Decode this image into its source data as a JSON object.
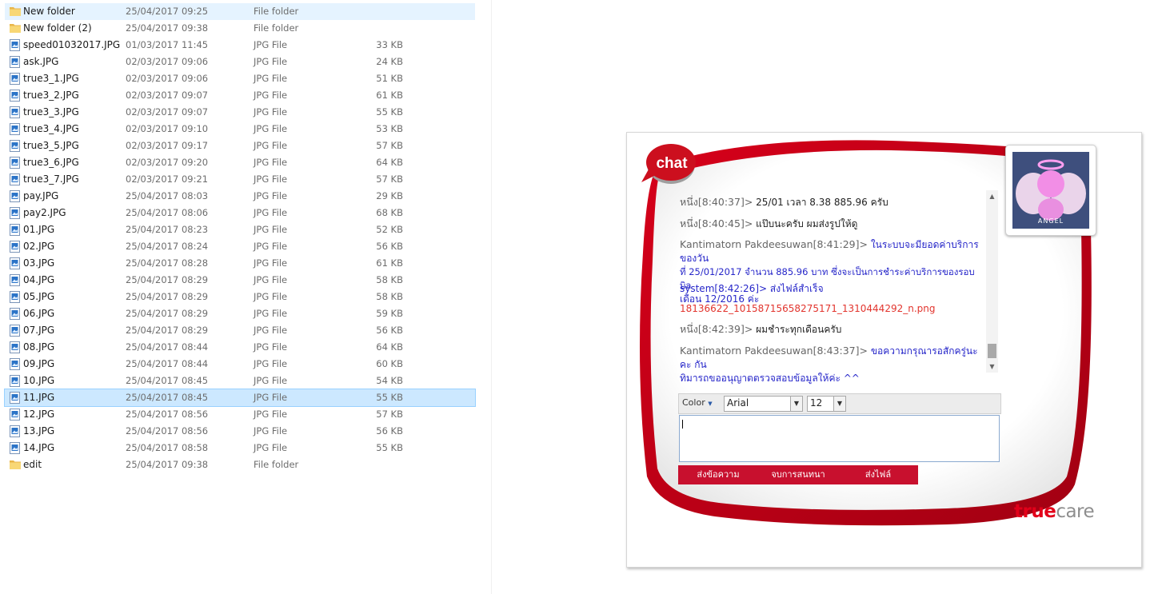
{
  "explorer": {
    "files": [
      {
        "name": "New folder",
        "date": "25/04/2017 09:25",
        "type": "File folder",
        "size": "",
        "icon": "folder-icon",
        "highlight": "light"
      },
      {
        "name": "New folder (2)",
        "date": "25/04/2017 09:38",
        "type": "File folder",
        "size": "",
        "icon": "folder-icon",
        "highlight": ""
      },
      {
        "name": "speed01032017.JPG",
        "date": "01/03/2017 11:45",
        "type": "JPG File",
        "size": "33 KB",
        "icon": "image-file-icon",
        "highlight": ""
      },
      {
        "name": "ask.JPG",
        "date": "02/03/2017 09:06",
        "type": "JPG File",
        "size": "24 KB",
        "icon": "image-file-icon",
        "highlight": ""
      },
      {
        "name": "true3_1.JPG",
        "date": "02/03/2017 09:06",
        "type": "JPG File",
        "size": "51 KB",
        "icon": "image-file-icon",
        "highlight": ""
      },
      {
        "name": "true3_2.JPG",
        "date": "02/03/2017 09:07",
        "type": "JPG File",
        "size": "61 KB",
        "icon": "image-file-icon",
        "highlight": ""
      },
      {
        "name": "true3_3.JPG",
        "date": "02/03/2017 09:07",
        "type": "JPG File",
        "size": "55 KB",
        "icon": "image-file-icon",
        "highlight": ""
      },
      {
        "name": "true3_4.JPG",
        "date": "02/03/2017 09:10",
        "type": "JPG File",
        "size": "53 KB",
        "icon": "image-file-icon",
        "highlight": ""
      },
      {
        "name": "true3_5.JPG",
        "date": "02/03/2017 09:17",
        "type": "JPG File",
        "size": "57 KB",
        "icon": "image-file-icon",
        "highlight": ""
      },
      {
        "name": "true3_6.JPG",
        "date": "02/03/2017 09:20",
        "type": "JPG File",
        "size": "64 KB",
        "icon": "image-file-icon",
        "highlight": ""
      },
      {
        "name": "true3_7.JPG",
        "date": "02/03/2017 09:21",
        "type": "JPG File",
        "size": "57 KB",
        "icon": "image-file-icon",
        "highlight": ""
      },
      {
        "name": "pay.JPG",
        "date": "25/04/2017 08:03",
        "type": "JPG File",
        "size": "29 KB",
        "icon": "image-file-icon",
        "highlight": ""
      },
      {
        "name": "pay2.JPG",
        "date": "25/04/2017 08:06",
        "type": "JPG File",
        "size": "68 KB",
        "icon": "image-file-icon",
        "highlight": ""
      },
      {
        "name": "01.JPG",
        "date": "25/04/2017 08:23",
        "type": "JPG File",
        "size": "52 KB",
        "icon": "image-file-icon",
        "highlight": ""
      },
      {
        "name": "02.JPG",
        "date": "25/04/2017 08:24",
        "type": "JPG File",
        "size": "56 KB",
        "icon": "image-file-icon",
        "highlight": ""
      },
      {
        "name": "03.JPG",
        "date": "25/04/2017 08:28",
        "type": "JPG File",
        "size": "61 KB",
        "icon": "image-file-icon",
        "highlight": ""
      },
      {
        "name": "04.JPG",
        "date": "25/04/2017 08:29",
        "type": "JPG File",
        "size": "58 KB",
        "icon": "image-file-icon",
        "highlight": ""
      },
      {
        "name": "05.JPG",
        "date": "25/04/2017 08:29",
        "type": "JPG File",
        "size": "58 KB",
        "icon": "image-file-icon",
        "highlight": ""
      },
      {
        "name": "06.JPG",
        "date": "25/04/2017 08:29",
        "type": "JPG File",
        "size": "59 KB",
        "icon": "image-file-icon",
        "highlight": ""
      },
      {
        "name": "07.JPG",
        "date": "25/04/2017 08:29",
        "type": "JPG File",
        "size": "56 KB",
        "icon": "image-file-icon",
        "highlight": ""
      },
      {
        "name": "08.JPG",
        "date": "25/04/2017 08:44",
        "type": "JPG File",
        "size": "64 KB",
        "icon": "image-file-icon",
        "highlight": ""
      },
      {
        "name": "09.JPG",
        "date": "25/04/2017 08:44",
        "type": "JPG File",
        "size": "60 KB",
        "icon": "image-file-icon",
        "highlight": ""
      },
      {
        "name": "10.JPG",
        "date": "25/04/2017 08:45",
        "type": "JPG File",
        "size": "54 KB",
        "icon": "image-file-icon",
        "highlight": ""
      },
      {
        "name": "11.JPG",
        "date": "25/04/2017 08:45",
        "type": "JPG File",
        "size": "55 KB",
        "icon": "image-file-icon",
        "highlight": "selected"
      },
      {
        "name": "12.JPG",
        "date": "25/04/2017 08:56",
        "type": "JPG File",
        "size": "57 KB",
        "icon": "image-file-icon",
        "highlight": ""
      },
      {
        "name": "13.JPG",
        "date": "25/04/2017 08:56",
        "type": "JPG File",
        "size": "56 KB",
        "icon": "image-file-icon",
        "highlight": ""
      },
      {
        "name": "14.JPG",
        "date": "25/04/2017 08:58",
        "type": "JPG File",
        "size": "55 KB",
        "icon": "image-file-icon",
        "highlight": ""
      },
      {
        "name": "edit",
        "date": "25/04/2017 09:38",
        "type": "File folder",
        "size": "",
        "icon": "folder-icon",
        "highlight": ""
      }
    ]
  },
  "chat": {
    "logo_text": "chat",
    "avatar_label": "ANGEL",
    "messages": {
      "m1_sender": "หนึ่ง[8:40:37]>",
      "m1_text": "25/01 เวลา 8.38 885.96 ครับ",
      "m2_sender": "หนึ่ง[8:40:45]>",
      "m2_text": "แป๊บนะครับ ผมส่งรูปให้ดู",
      "m3_sender": "Kantimatorn Pakdeesuwan[8:41:29]>",
      "m3_text_1": "ในระบบจะมียอดค่าบริการของวัน",
      "m3_text_2": "ที่ 25/01/2017 จำนวน 885.96 บาท ซึ่งจะเป็นการชำระค่าบริการของรอบบิล",
      "m3_text_3": "เดือน 12/2016 ค่ะ",
      "m4_sender": "system[8:42:26]>",
      "m4_text": "ส่งไฟล์สำเร็จ",
      "m5_file": "18136622_10158715658275171_1310444292_n.png",
      "m6_sender": "หนึ่ง[8:42:39]>",
      "m6_text": "ผมชำระทุกเดือนครับ",
      "m7_sender": "Kantimatorn Pakdeesuwan[8:43:37]>",
      "m7_text_1": "ขอความกรุณารอสักครู่นะคะ กัน",
      "m7_text_2": "ทิมารถขออนุญาตตรวจสอบข้อมูลให้ค่ะ ^^"
    },
    "toolbar": {
      "color_label": "Color",
      "font_value": "Arial",
      "size_value": "12"
    },
    "input": {
      "value": ""
    },
    "actions": {
      "send_label": "ส่งข้อความ",
      "end_label": "จบการสนทนา",
      "file_label": "ส่งไฟล์"
    },
    "brand": {
      "part1": "true",
      "part2": "care"
    }
  },
  "colors": {
    "brand_red": "#e2001a",
    "button_red": "#c8102e",
    "agent_text_blue": "#2626c9",
    "file_link_red": "#e2342d",
    "selection_blue": "#cce8ff"
  }
}
